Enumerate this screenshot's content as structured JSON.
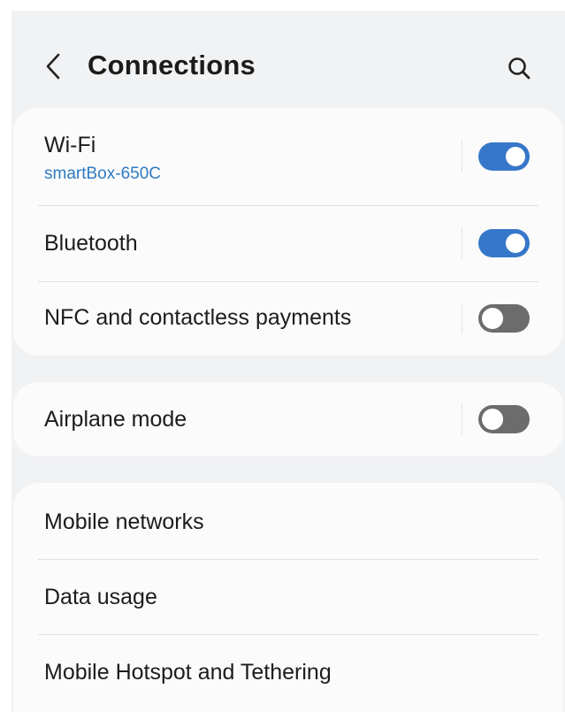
{
  "header": {
    "title": "Connections",
    "back_icon": "chevron-left-icon",
    "search_icon": "search-icon"
  },
  "groups": [
    {
      "items": [
        {
          "label": "Wi-Fi",
          "subtitle": "smartBox-650C",
          "toggle": "on"
        },
        {
          "label": "Bluetooth",
          "toggle": "on"
        },
        {
          "label": "NFC and contactless payments",
          "toggle": "off"
        }
      ]
    },
    {
      "items": [
        {
          "label": "Airplane mode",
          "toggle": "off"
        }
      ]
    },
    {
      "items": [
        {
          "label": "Mobile networks"
        },
        {
          "label": "Data usage"
        },
        {
          "label": "Mobile Hotspot and Tethering"
        }
      ]
    }
  ],
  "colors": {
    "accent": "#3777c9",
    "subtitle": "#2f7bc2",
    "toggle_off": "#6c6c6c",
    "background": "#f1f2f4",
    "card": "#fbfbfb"
  }
}
